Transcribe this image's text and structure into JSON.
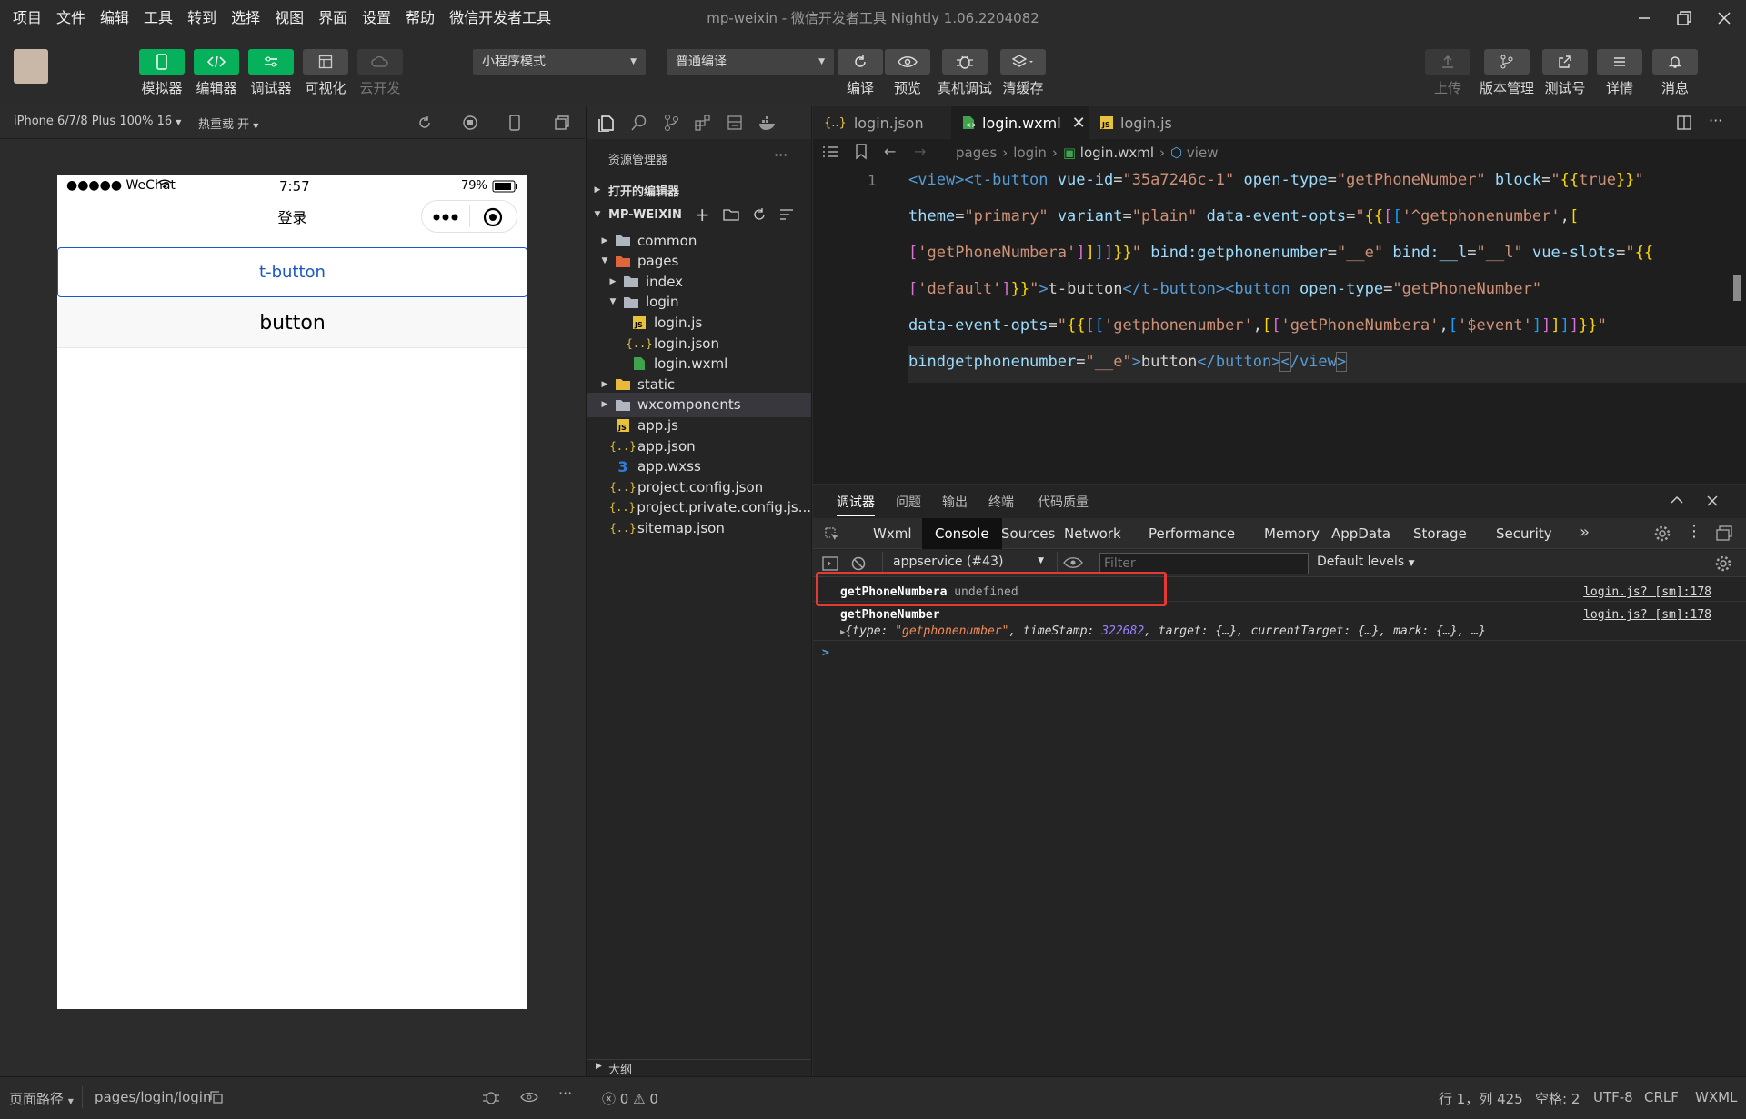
{
  "menu": [
    "项目",
    "文件",
    "编辑",
    "工具",
    "转到",
    "选择",
    "视图",
    "界面",
    "设置",
    "帮助",
    "微信开发者工具"
  ],
  "window_title": "mp-weixin - 微信开发者工具 Nightly 1.06.2204082",
  "toolbar": {
    "simulator": "模拟器",
    "editor": "编辑器",
    "debugger": "调试器",
    "visual": "可视化",
    "cloud": "云开发",
    "mode_select": "小程序模式",
    "compile_select": "普通编译",
    "compile": "编译",
    "preview": "预览",
    "real_debug": "真机调试",
    "clear_cache": "清缓存",
    "upload": "上传",
    "version": "版本管理",
    "test_account": "测试号",
    "details": "详情",
    "messages": "消息"
  },
  "simulator": {
    "device": "iPhone 6/7/8 Plus 100% 16",
    "hot_reload": "热重载 开",
    "status_carrier": "●●●●● WeChat",
    "status_time": "7:57",
    "status_battery": "79%",
    "nav_title": "登录",
    "t_button": "t-button",
    "button": "button"
  },
  "explorer": {
    "title": "资源管理器",
    "open_editors": "打开的编辑器",
    "project": "MP-WEIXIN",
    "outline": "大纲",
    "tree": [
      {
        "label": "common",
        "type": "folder",
        "depth": 1,
        "open": false
      },
      {
        "label": "pages",
        "type": "folder-red",
        "depth": 1,
        "open": true
      },
      {
        "label": "index",
        "type": "folder",
        "depth": 2,
        "open": false
      },
      {
        "label": "login",
        "type": "folder",
        "depth": 2,
        "open": true
      },
      {
        "label": "login.js",
        "type": "js",
        "depth": 3
      },
      {
        "label": "login.json",
        "type": "json",
        "depth": 3
      },
      {
        "label": "login.wxml",
        "type": "wxml",
        "depth": 3
      },
      {
        "label": "static",
        "type": "folder-yellow",
        "depth": 1,
        "open": false
      },
      {
        "label": "wxcomponents",
        "type": "folder",
        "depth": 1,
        "open": false,
        "selected": true
      },
      {
        "label": "app.js",
        "type": "js",
        "depth": 1
      },
      {
        "label": "app.json",
        "type": "json",
        "depth": 1
      },
      {
        "label": "app.wxss",
        "type": "wxss",
        "depth": 1
      },
      {
        "label": "project.config.json",
        "type": "json",
        "depth": 1
      },
      {
        "label": "project.private.config.js...",
        "type": "json",
        "depth": 1
      },
      {
        "label": "sitemap.json",
        "type": "json",
        "depth": 1
      }
    ]
  },
  "editor": {
    "tabs": [
      "login.json",
      "login.wxml",
      "login.js"
    ],
    "breadcrumb": [
      "pages",
      "login",
      "login.wxml",
      "view"
    ],
    "line_number": "1"
  },
  "debugger": {
    "top_tabs": [
      "调试器",
      "问题",
      "输出",
      "终端",
      "代码质量"
    ],
    "dev_tabs": [
      "Wxml",
      "Console",
      "Sources",
      "Network",
      "Performance",
      "Memory",
      "AppData",
      "Storage",
      "Security"
    ],
    "context": "appservice (#43)",
    "filter_placeholder": "Filter",
    "levels": "Default levels",
    "log1_name": "getPhoneNumbera",
    "log1_value": "undefined",
    "log1_src": "login.js? [sm]:178",
    "log2_name": "getPhoneNumber",
    "log2_src": "login.js? [sm]:178",
    "log2_obj_prefix": "{type: ",
    "log2_type": "\"getphonenumber\"",
    "log2_mid": ", timeStamp: ",
    "log2_ts": "322682",
    "log2_rest": ", target: {…}, currentTarget: {…}, mark: {…}, …}",
    "prompt": ">"
  },
  "statusbar": {
    "page_path_label": "页面路径",
    "page_path": "pages/login/login",
    "errors": "0",
    "warnings": "0",
    "position": "行 1，列 425",
    "spaces": "空格: 2",
    "encoding": "UTF-8",
    "eol": "CRLF",
    "language": "WXML"
  },
  "colors": {
    "accent_green": "#07b05a",
    "link_blue": "#1a56c4",
    "highlight_red": "#e53935"
  }
}
